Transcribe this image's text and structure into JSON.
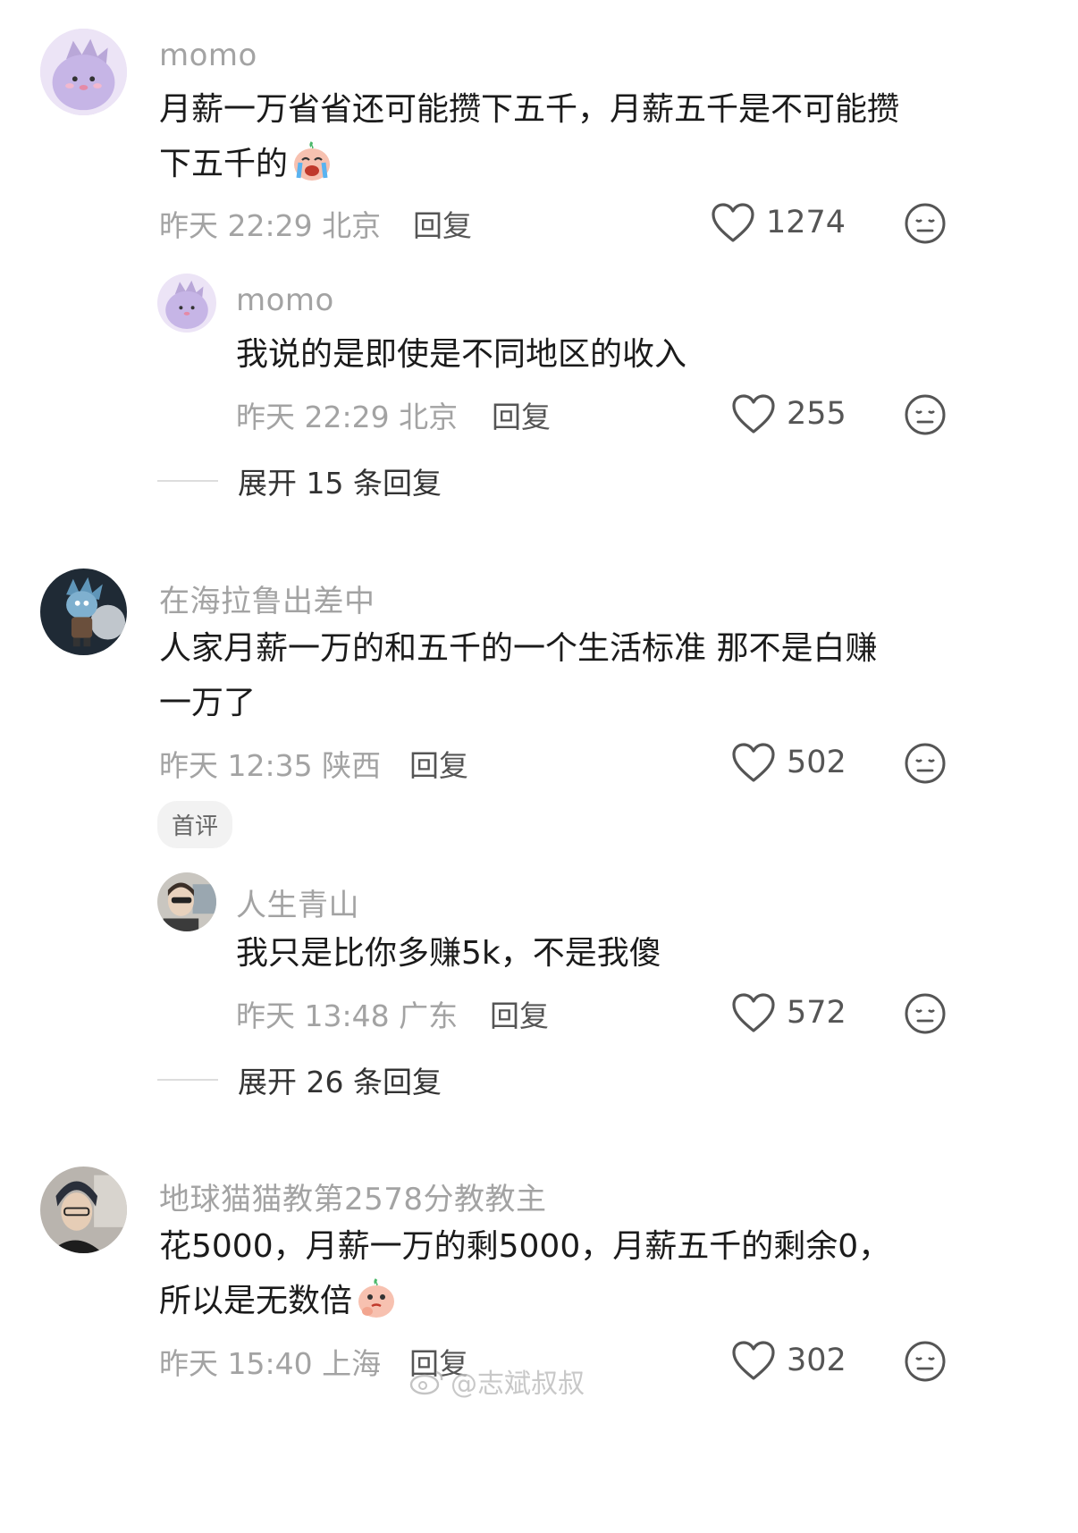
{
  "comments": [
    {
      "user": "momo",
      "text_lines": [
        "月薪一万省省还可能攒下五千，月薪五千是不可能攒",
        "下五千的"
      ],
      "emoji": "crying-face-emoji",
      "time_location": "昨天 22:29 北京",
      "reply_label": "回复",
      "likes": "1274",
      "replies": [
        {
          "user": "momo",
          "text_lines": [
            "我说的是即使是不同地区的收入"
          ],
          "time_location": "昨天 22:29 北京",
          "reply_label": "回复",
          "likes": "255"
        }
      ],
      "expand_label": "展开 15 条回复"
    },
    {
      "user": "在海拉鲁出差中",
      "text_lines": [
        "人家月薪一万的和五千的一个生活标准 那不是白赚",
        "一万了"
      ],
      "time_location": "昨天 12:35 陕西",
      "reply_label": "回复",
      "likes": "502",
      "badge": "首评",
      "replies": [
        {
          "user": "人生青山",
          "text_lines": [
            "我只是比你多赚5k，不是我傻"
          ],
          "time_location": "昨天 13:48 广东",
          "reply_label": "回复",
          "likes": "572"
        }
      ],
      "expand_label": "展开 26 条回复"
    },
    {
      "user": "地球猫猫教第2578分教教主",
      "text_lines": [
        "花5000，月薪一万的剩5000，月薪五千的剩余0，",
        "所以是无数倍"
      ],
      "emoji": "thinking-face-emoji",
      "time_location": "昨天 15:40 上海",
      "reply_label": "回复",
      "likes": "302"
    }
  ],
  "watermark": "@志斌叔叔",
  "icons": {
    "like": "heart-outline-icon",
    "dislike": "neutral-face-icon",
    "watermark_logo": "weibo-logo-icon"
  },
  "colors": {
    "username": "#a3a3a3",
    "text": "#1b1b1b",
    "meta": "#a3a3a3",
    "icon": "#555555"
  }
}
